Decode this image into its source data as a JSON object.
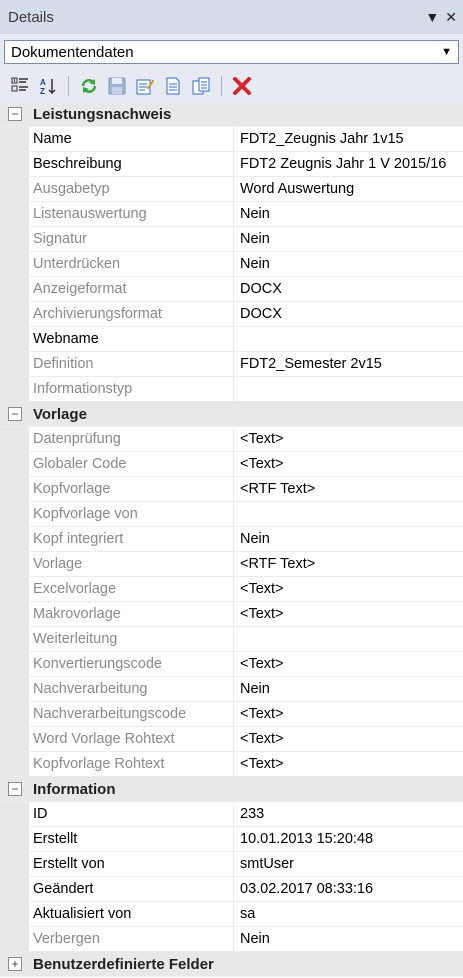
{
  "panel": {
    "title": "Details"
  },
  "selector": {
    "value": "Dokumentendaten"
  },
  "toolbar_icons": [
    "categorized-icon",
    "alphabetical-sort-icon",
    "refresh-icon",
    "save-icon",
    "edit-icon",
    "document-icon",
    "copy-icon",
    "delete-icon"
  ],
  "categories": [
    {
      "label": "Leistungsnachweis",
      "expanded": true,
      "rows": [
        {
          "name": "Name",
          "value": "FDT2_Zeugnis Jahr 1v15",
          "readonly": false
        },
        {
          "name": "Beschreibung",
          "value": "FDT2 Zeugnis Jahr 1 V 2015/16",
          "readonly": false
        },
        {
          "name": "Ausgabetyp",
          "value": "Word Auswertung",
          "readonly": true
        },
        {
          "name": "Listenauswertung",
          "value": "Nein",
          "readonly": true
        },
        {
          "name": "Signatur",
          "value": "Nein",
          "readonly": true
        },
        {
          "name": "Unterdrücken",
          "value": "Nein",
          "readonly": true
        },
        {
          "name": "Anzeigeformat",
          "value": "DOCX",
          "readonly": true
        },
        {
          "name": "Archivierungsformat",
          "value": "DOCX",
          "readonly": true
        },
        {
          "name": "Webname",
          "value": "",
          "readonly": false
        },
        {
          "name": "Definition",
          "value": "FDT2_Semester 2v15",
          "readonly": true
        },
        {
          "name": "Informationstyp",
          "value": "",
          "readonly": true
        }
      ]
    },
    {
      "label": "Vorlage",
      "expanded": true,
      "rows": [
        {
          "name": "Datenprüfung",
          "value": "<Text>",
          "readonly": true
        },
        {
          "name": "Globaler Code",
          "value": "<Text>",
          "readonly": true
        },
        {
          "name": "Kopfvorlage",
          "value": "<RTF Text>",
          "readonly": true
        },
        {
          "name": "Kopfvorlage von",
          "value": "",
          "readonly": true
        },
        {
          "name": "Kopf integriert",
          "value": "Nein",
          "readonly": true
        },
        {
          "name": "Vorlage",
          "value": "<RTF Text>",
          "readonly": true
        },
        {
          "name": "Excelvorlage",
          "value": "<Text>",
          "readonly": true
        },
        {
          "name": "Makrovorlage",
          "value": "<Text>",
          "readonly": true
        },
        {
          "name": "Weiterleitung",
          "value": "",
          "readonly": true
        },
        {
          "name": "Konvertierungscode",
          "value": "<Text>",
          "readonly": true
        },
        {
          "name": "Nachverarbeitung",
          "value": "Nein",
          "readonly": true
        },
        {
          "name": "Nachverarbeitungscode",
          "value": "<Text>",
          "readonly": true
        },
        {
          "name": "Word Vorlage Rohtext",
          "value": "<Text>",
          "readonly": true
        },
        {
          "name": "Kopfvorlage Rohtext",
          "value": "<Text>",
          "readonly": true
        }
      ]
    },
    {
      "label": "Information",
      "expanded": true,
      "rows": [
        {
          "name": "ID",
          "value": "233",
          "readonly": false
        },
        {
          "name": "Erstellt",
          "value": "10.01.2013 15:20:48",
          "readonly": false
        },
        {
          "name": "Erstellt von",
          "value": "smtUser",
          "readonly": false
        },
        {
          "name": "Geändert",
          "value": "03.02.2017 08:33:16",
          "readonly": false
        },
        {
          "name": "Aktualisiert von",
          "value": "sa",
          "readonly": false
        },
        {
          "name": "Verbergen",
          "value": "Nein",
          "readonly": true
        }
      ]
    },
    {
      "label": "Benutzerdefinierte Felder",
      "expanded": false,
      "rows": []
    }
  ],
  "toggle_symbols": {
    "expanded": "−",
    "collapsed": "+"
  }
}
